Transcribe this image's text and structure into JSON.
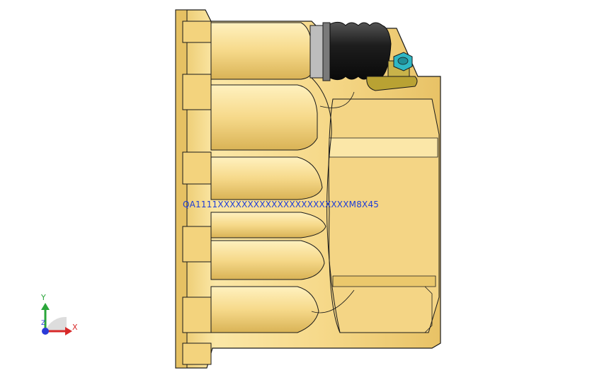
{
  "viewport": {
    "background": "#ffffff",
    "part_color": "#f2d78a",
    "part_shade": "#e2bd5c",
    "edge_color": "#1a1a1a"
  },
  "annotations": {
    "dimension_text": "QA1111XXXXXXXXXXXXXXXXXXXXXXM8X45"
  },
  "triad": {
    "x_label": "X",
    "y_label": "Y",
    "z_label": "Z",
    "x_color": "#d82a2a",
    "y_color": "#2aa63a",
    "z_color": "#2a3ad8"
  },
  "components": {
    "boot_color": "#1b1b1b",
    "nut_color": "#2fb7c4",
    "bracket_color": "#b9a233"
  }
}
